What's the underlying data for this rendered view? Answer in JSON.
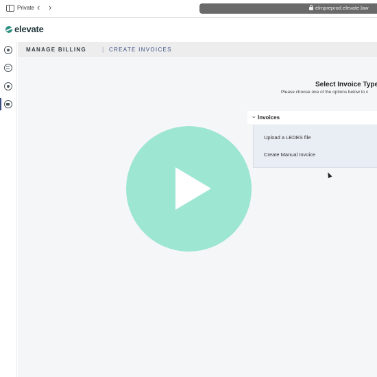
{
  "browser": {
    "private_label": "Private",
    "back_glyph": "‹",
    "forward_glyph": "›",
    "url": "elmpreprod.elevate.law"
  },
  "app": {
    "brand": "elevate",
    "brand_color": "#2f8f80"
  },
  "rail": {
    "icons": [
      "location-icon",
      "list-icon",
      "bulb-icon",
      "billing-icon"
    ]
  },
  "breadcrumb": {
    "parent": "MANAGE BILLING",
    "separator": "|",
    "current": "CREATE INVOICES"
  },
  "main": {
    "title": "Select Invoice Type",
    "subtitle": "Please choose one of the options below to c",
    "section": {
      "chevron": "⌄",
      "label": "Invoices"
    },
    "options": [
      "Upload a LEDES file",
      "Create Manual Invoice"
    ]
  },
  "overlay": {
    "play_color": "#9de6d1"
  }
}
